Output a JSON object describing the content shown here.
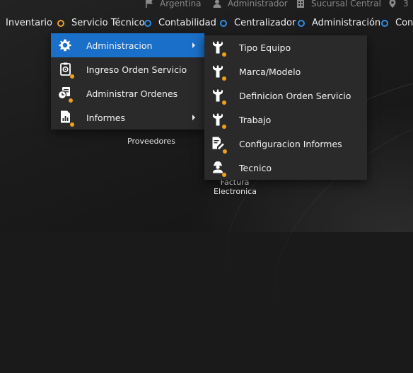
{
  "status_bar": {
    "country": "Argentina",
    "user": "Administrador",
    "branch": "Sucursal Central",
    "location_count": "3"
  },
  "nav": {
    "items": [
      {
        "label": "Inventario"
      },
      {
        "label": "Servicio Técnico"
      },
      {
        "label": "Contabilidad"
      },
      {
        "label": "Centralizador"
      },
      {
        "label": "Administración"
      },
      {
        "label": "Con"
      }
    ]
  },
  "background": {
    "proveedores": "Proveedores",
    "factura_line1": "Factura",
    "factura_line2": "Electronica"
  },
  "main_menu": {
    "items": [
      {
        "label": "Administracion",
        "icon": "gear-icon"
      },
      {
        "label": "Ingreso Orden Servicio",
        "icon": "clipboard-icon"
      },
      {
        "label": "Administrar Ordenes",
        "icon": "orders-clock-icon"
      },
      {
        "label": "Informes",
        "icon": "report-chart-icon"
      }
    ]
  },
  "submenu": {
    "items": [
      {
        "label": "Tipo Equipo",
        "icon": "wrench-icon"
      },
      {
        "label": "Marca/Modelo",
        "icon": "wrench-icon"
      },
      {
        "label": "Definicion Orden Servicio",
        "icon": "wrench-icon"
      },
      {
        "label": "Trabajo",
        "icon": "wrench-icon"
      },
      {
        "label": "Configuracion Informes",
        "icon": "document-edit-icon"
      },
      {
        "label": "Tecnico",
        "icon": "technician-icon"
      }
    ]
  },
  "colors": {
    "accent": "#1a6fc8",
    "badge": "#f0a020",
    "nav_dot_blue": "#2f8fe6",
    "nav_dot_orange": "#f0a030",
    "menu_bg": "#2a2a2a"
  }
}
